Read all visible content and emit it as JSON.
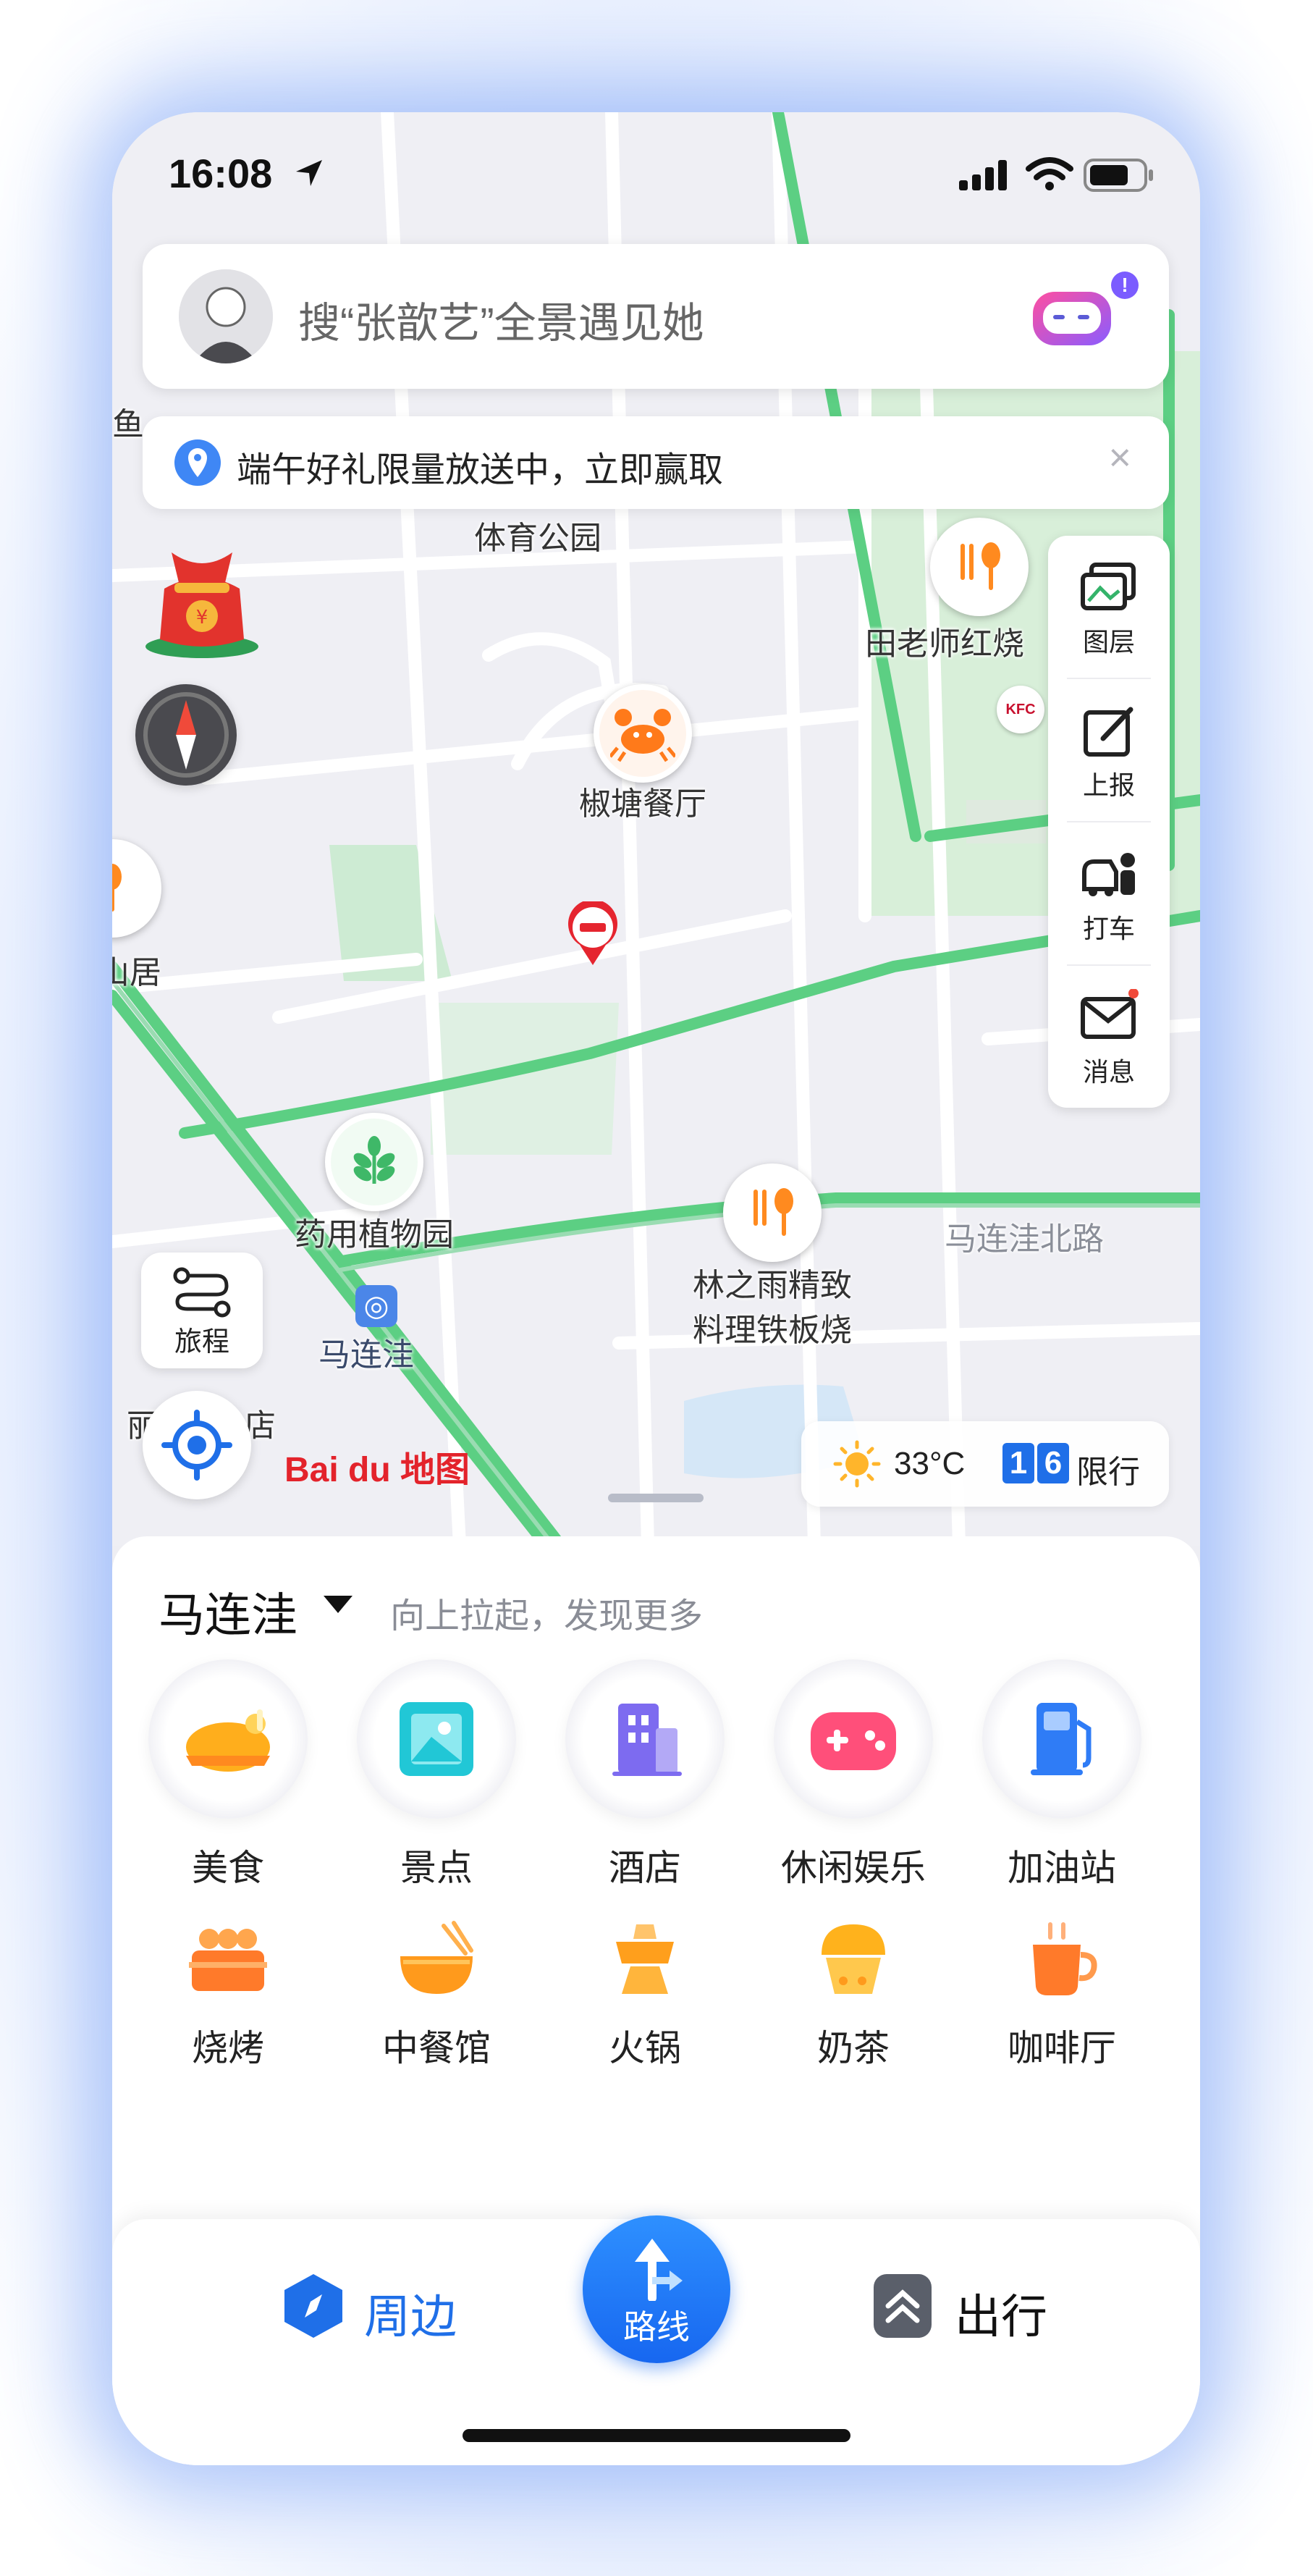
{
  "status_bar": {
    "time": "16:08"
  },
  "search": {
    "placeholder": "搜“张歆艺”全景遇见她",
    "badge": "!"
  },
  "notice": {
    "text": "端午好礼限量放送中，立即赢取",
    "close": "×"
  },
  "map_labels": {
    "sports_park": "体育公园",
    "tian_laoshi": "田老师红烧",
    "jiaotang": "椒塘餐厅",
    "left_residence": "山居",
    "yaoyong": "药用植物园",
    "lin_zhiyu_1": "林之雨精致",
    "lin_zhiyu_2": "料理铁板烧",
    "malianwa_north": "马连洼北路",
    "malianwa_station": "马连洼",
    "left_fish": "鱼",
    "left_hotel": "店",
    "left_li": "丽",
    "kfc": "KFC"
  },
  "toolbar": {
    "layers": "图层",
    "report": "上报",
    "taxi": "打车",
    "messages": "消息"
  },
  "trip": {
    "label": "旅程"
  },
  "weather": {
    "temp": "33°C",
    "plate1": "1",
    "plate2": "6",
    "restriction": "限行"
  },
  "brand": {
    "logo": "Bai du 地图"
  },
  "panel": {
    "location": "马连洼",
    "hint": "向上拉起，发现更多",
    "categories": [
      {
        "label": "美食",
        "icon": "roast-chicken-icon"
      },
      {
        "label": "景点",
        "icon": "picture-icon"
      },
      {
        "label": "酒店",
        "icon": "hotel-building-icon"
      },
      {
        "label": "休闲娱乐",
        "icon": "gamepad-icon"
      },
      {
        "label": "加油站",
        "icon": "fuel-pump-icon"
      }
    ],
    "subcategories": [
      {
        "label": "烧烤",
        "icon": "bbq-icon"
      },
      {
        "label": "中餐馆",
        "icon": "rice-bowl-icon"
      },
      {
        "label": "火锅",
        "icon": "hotpot-icon"
      },
      {
        "label": "奶茶",
        "icon": "milk-tea-icon"
      },
      {
        "label": "咖啡厅",
        "icon": "coffee-cup-icon"
      }
    ]
  },
  "nav": {
    "nearby": "周边",
    "route": "路线",
    "travel": "出行"
  },
  "colors": {
    "accent": "#1f6fe8",
    "road_green": "#5ccf83",
    "map_bg": "#efeff4"
  }
}
